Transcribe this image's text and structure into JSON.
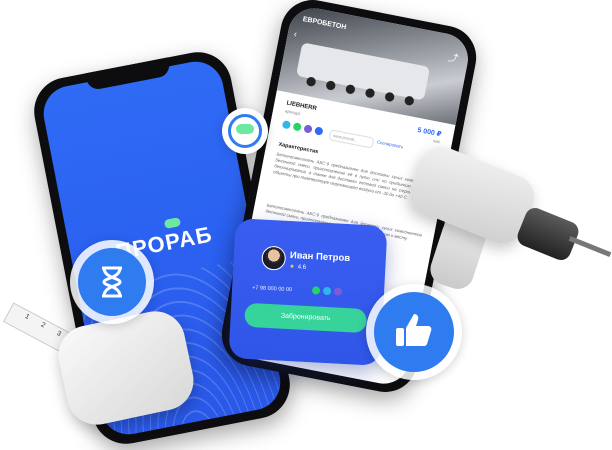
{
  "left_phone": {
    "logo_text": "ПРОРАБ"
  },
  "right_phone": {
    "hero_brand": "ЕВРОБЕТОН",
    "product_title": "LIEBHERR",
    "product_sub": "аренда",
    "price": "5 000 ₽",
    "price_unit": "час",
    "site_placeholder": "www.proraб...",
    "copy_label": "Скопировать",
    "section_heading": "Характеристик",
    "description_1": "Бетоносмеситель АБС-9 предназначен для доставки сухих компонентов бетонной смеси, приготовлению её в пути или по прибытию к месту бетонирования, а также для доставки готовой смеси на строительные объекты при температуре окружающего воздуха от -30 до +40 С.",
    "description_2": "Бетоносмеситель АБС-9 предназначен для доставки сухих компонентов бетонной смеси, приготовлению её в пути или по прибытию к месту"
  },
  "contact_card": {
    "name": "Иван Петров",
    "rating": "4.6",
    "phone": "+7 98 000 00 00",
    "book_button": "Забронировать"
  },
  "tape_marks": [
    "1",
    "2",
    "3"
  ],
  "colors": {
    "brand_blue": "#2f6bf5",
    "accent_green": "#36d39a",
    "badge_blue": "#2f7cf0"
  },
  "icons": [
    "hourglass-icon",
    "thumbs-up-icon",
    "cloud-icon",
    "whatsapp-icon",
    "telegram-icon",
    "viber-icon"
  ]
}
